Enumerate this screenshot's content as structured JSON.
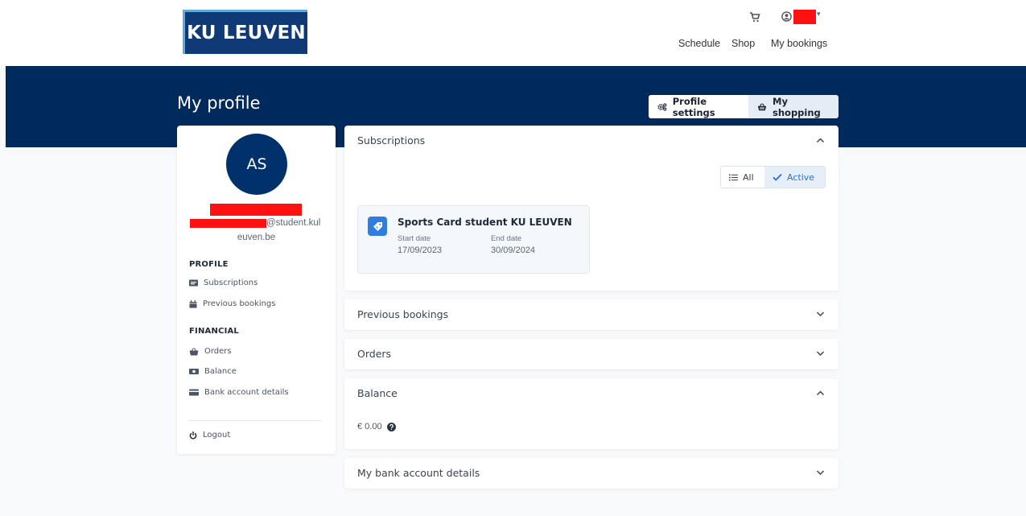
{
  "logo": {
    "text": "KU LEUVEN"
  },
  "nav": {
    "cart_icon": "cart-icon",
    "user_icon": "user-circle-icon",
    "items": [
      "Schedule",
      "Shop",
      "My bookings"
    ]
  },
  "header": {
    "title": "My profile",
    "profile_settings": "Profile settings",
    "my_shopping": "My shopping"
  },
  "profile": {
    "initials": "AS",
    "email_part1": "@student.kul",
    "email_part2": "euven.be",
    "section_profile": "PROFILE",
    "link_subscriptions": "Subscriptions",
    "link_previous_bookings": "Previous bookings",
    "section_financial": "FINANCIAL",
    "link_orders": "Orders",
    "link_balance": "Balance",
    "link_bank": "Bank account details",
    "logout": "Logout"
  },
  "subscriptions": {
    "title": "Subscriptions",
    "filter_all": "All",
    "filter_active": "Active",
    "card": {
      "title": "Sports Card student KU LEUVEN",
      "start_label": "Start date",
      "start_value": "17/09/2023",
      "end_label": "End date",
      "end_value": "30/09/2024"
    }
  },
  "previous_bookings": {
    "title": "Previous bookings"
  },
  "orders": {
    "title": "Orders"
  },
  "balance": {
    "title": "Balance",
    "value": "€ 0.00"
  },
  "bank": {
    "title": "My bank account details"
  },
  "colors": {
    "brand_blue": "#002a5c",
    "accent_blue": "#2f7de1",
    "redaction": "#ff1111"
  }
}
